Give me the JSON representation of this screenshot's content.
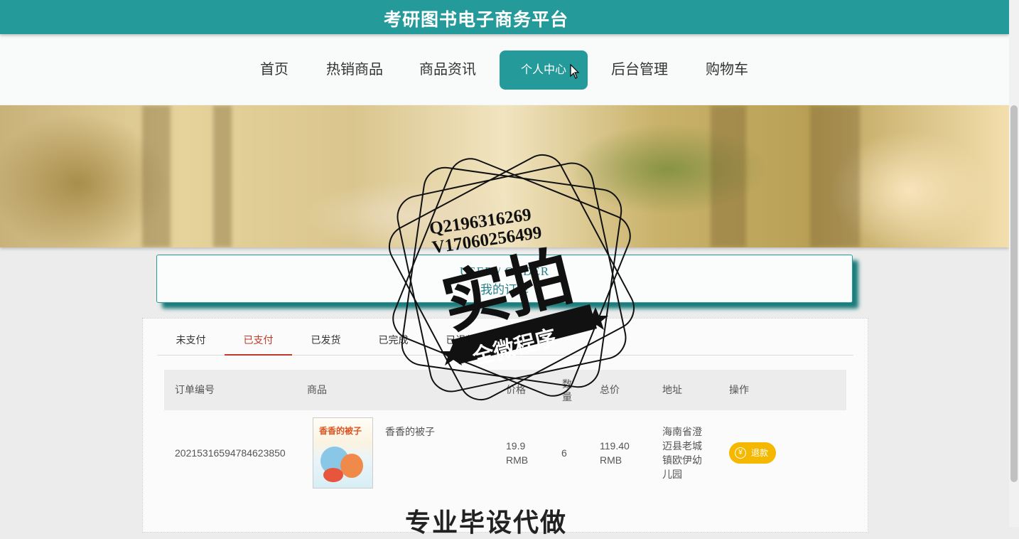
{
  "header": {
    "title": "考研图书电子商务平台"
  },
  "nav": {
    "items": [
      {
        "label": "首页"
      },
      {
        "label": "热销商品"
      },
      {
        "label": "商品资讯"
      },
      {
        "label": "个人中心"
      },
      {
        "label": "后台管理"
      },
      {
        "label": "购物车"
      }
    ],
    "active": "个人中心"
  },
  "order_section": {
    "title_en": "USER / ORDER",
    "title_cn": "我的订单"
  },
  "tabs": [
    {
      "label": "未支付"
    },
    {
      "label": "已支付"
    },
    {
      "label": "已发货"
    },
    {
      "label": "已完成"
    },
    {
      "label": "已退款"
    }
  ],
  "active_tab": "已支付",
  "table": {
    "headers": {
      "order_no": "订单编号",
      "product": "商品",
      "price": "价格",
      "qty": "数量",
      "total": "总价",
      "address": "地址",
      "action": "操作"
    },
    "rows": [
      {
        "order_no": "20215316594784623850",
        "product_name": "香香的被子",
        "cover_title": "香香的被子",
        "price": "19.9",
        "price_unit": "RMB",
        "qty": "6",
        "total": "119.40",
        "total_unit": "RMB",
        "address": "海南省澄迈县老城镇欧伊幼儿园",
        "action_label": "退款"
      }
    ]
  },
  "watermark": {
    "line1": "Q2196316269",
    "line2": "V17060256499",
    "stamp_main": "实拍",
    "stamp_sub": "全微程序",
    "bottom": "专业毕设代做"
  }
}
